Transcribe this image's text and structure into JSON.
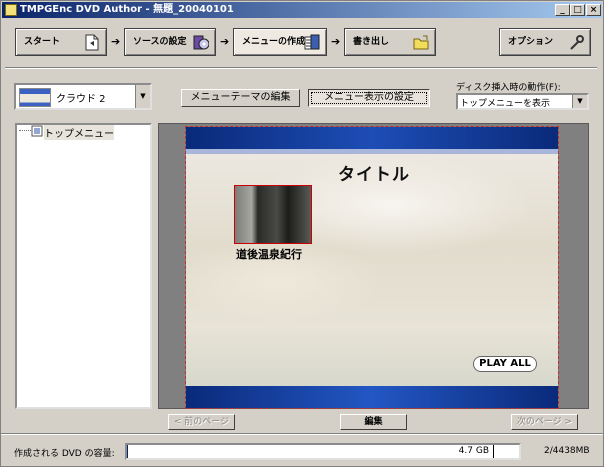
{
  "window": {
    "title": "TMPGEnc DVD Author - 無題_20040101",
    "controls": {
      "minimize": "_",
      "maximize": "□",
      "close": "×"
    }
  },
  "steps": [
    {
      "label": "スタート",
      "icon": "start-doc-icon"
    },
    {
      "label": "ソースの設定",
      "icon": "source-disc-icon"
    },
    {
      "label": "メニューの作成",
      "icon": "menu-create-icon"
    },
    {
      "label": "書き出し",
      "icon": "export-folder-icon"
    }
  ],
  "step_arrow": "➔",
  "options_button": {
    "label": "オプション",
    "icon": "wrench-icon"
  },
  "theme_select": {
    "value": "クラウド 2"
  },
  "edit_theme_button": "メニューテーマの編集",
  "display_settings_button": "メニュー表示の設定",
  "disc_insert": {
    "label": "ディスク挿入時の動作(F):",
    "value": "トップメニューを表示"
  },
  "tree": {
    "root_label": "トップメニュー"
  },
  "preview": {
    "title": "タイトル",
    "item_caption": "道後温泉紀行",
    "play_all": "PLAY ALL"
  },
  "pager": {
    "prev": "< 前のページ",
    "edit": "編集",
    "next": "次のページ >"
  },
  "status": {
    "label": "作成される DVD の容量:",
    "capacity_text": "4.7 GB",
    "usage_text": "2/4438MB",
    "usage_fraction": 0.0005
  }
}
